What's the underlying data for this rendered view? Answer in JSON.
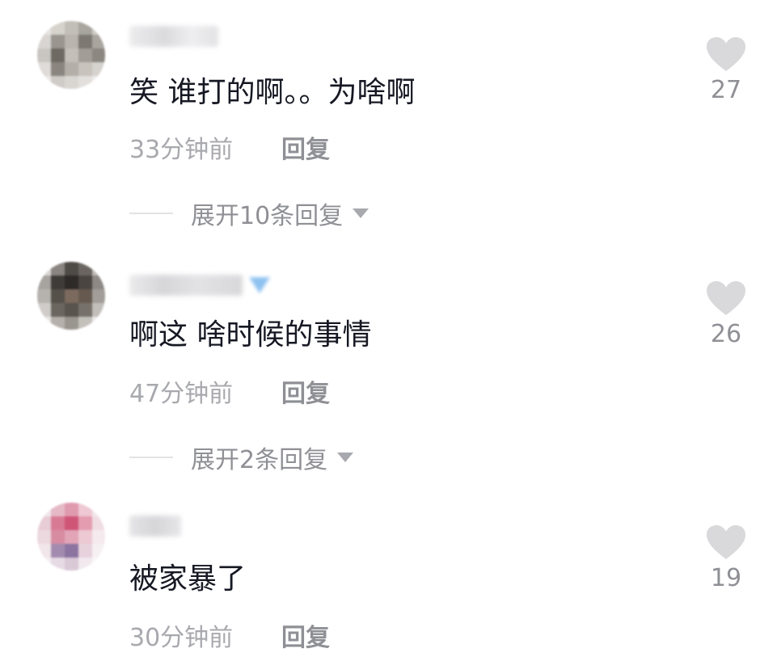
{
  "comments": [
    {
      "text": "笑 谁打的啊。。为啥啊",
      "time": "33分钟前",
      "reply_label": "回复",
      "likes": "27",
      "expand_label": "展开10条回复",
      "icon": "heart-icon",
      "avatar_style": "grey"
    },
    {
      "text": "啊这 啥时候的事情",
      "time": "47分钟前",
      "reply_label": "回复",
      "likes": "26",
      "expand_label": "展开2条回复",
      "icon": "heart-icon",
      "avatar_style": "dark"
    },
    {
      "text": "被家暴了",
      "time": "30分钟前",
      "reply_label": "回复",
      "likes": "19",
      "expand_label": null,
      "icon": "heart-icon",
      "avatar_style": "pink"
    }
  ],
  "colors": {
    "text_primary": "#161823",
    "text_secondary": "#a8a9ae",
    "reply": "#8f9095",
    "heart": "#d9d9db",
    "verified_badge": "#8fc2f0"
  }
}
